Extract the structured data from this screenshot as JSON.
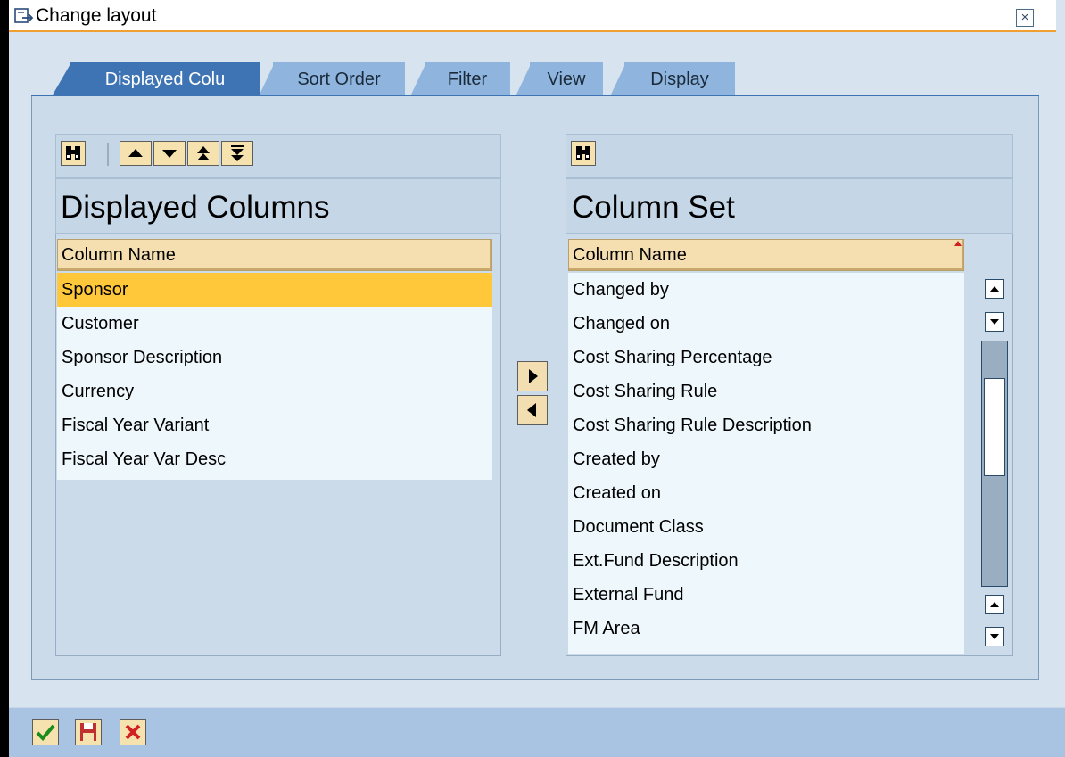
{
  "window": {
    "title": "Change layout",
    "close_icon": "close-icon"
  },
  "tabs": [
    {
      "label": "Displayed Colu",
      "active": true
    },
    {
      "label": "Sort Order",
      "active": false
    },
    {
      "label": "Filter",
      "active": false
    },
    {
      "label": "View",
      "active": false
    },
    {
      "label": "Display",
      "active": false
    }
  ],
  "left_pane": {
    "heading": "Displayed Columns",
    "column_header": "Column Name",
    "toolbar_icons": [
      "find-icon",
      "move-up-icon",
      "move-down-icon",
      "move-top-icon",
      "move-bottom-icon"
    ],
    "rows": [
      {
        "label": "Sponsor",
        "selected": true
      },
      {
        "label": "Customer",
        "selected": false
      },
      {
        "label": "Sponsor Description",
        "selected": false
      },
      {
        "label": "Currency",
        "selected": false
      },
      {
        "label": "Fiscal Year Variant",
        "selected": false
      },
      {
        "label": "Fiscal Year Var Desc",
        "selected": false
      }
    ]
  },
  "right_pane": {
    "heading": "Column Set",
    "column_header": "Column Name",
    "toolbar_icons": [
      "find-icon"
    ],
    "rows": [
      "Changed by",
      "Changed on",
      "Cost Sharing Percentage",
      "Cost Sharing Rule",
      "Cost Sharing Rule Description",
      "Created by",
      "Created on",
      "Document Class",
      "Ext.Fund Description",
      "External Fund",
      "FM Area"
    ]
  },
  "transfer_icons": [
    "move-right-icon",
    "move-left-icon"
  ],
  "footer_icons": [
    "confirm-check-icon",
    "save-icon",
    "cancel-icon"
  ],
  "colors": {
    "active_tab": "#3e74b3",
    "inactive_tab": "#8fb5de",
    "selected_row": "#ffc83a",
    "header_fill": "#f5deb0",
    "panel_bg": "#ccdbe9",
    "title_accent": "#f0a030"
  }
}
